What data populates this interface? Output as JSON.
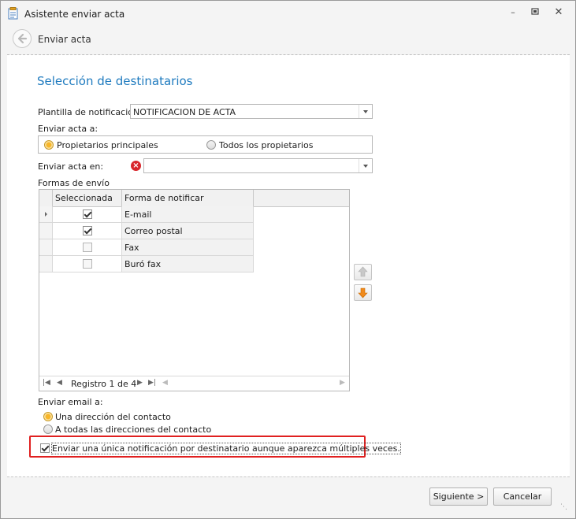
{
  "window": {
    "title": "Asistente enviar acta"
  },
  "header": {
    "title": "Enviar acta"
  },
  "section": {
    "title": "Selección de destinatarios"
  },
  "form": {
    "plantilla_label": "Plantilla de notificación:",
    "plantilla_value": "NOTIFICACION DE ACTA",
    "enviar_acta_a_label": "Enviar acta a:",
    "enviar_acta_a_options": [
      {
        "label": "Propietarios principales",
        "selected": true
      },
      {
        "label": "Todos los propietarios",
        "selected": false
      }
    ],
    "enviar_en_label": "Enviar acta en:",
    "enviar_en_value": "",
    "formas_label": "Formas de envío"
  },
  "grid": {
    "columns": [
      "Seleccionada",
      "Forma de notificar"
    ],
    "rows": [
      {
        "selected": true,
        "forma": "E-mail"
      },
      {
        "selected": true,
        "forma": "Correo postal"
      },
      {
        "selected": false,
        "forma": "Fax"
      },
      {
        "selected": false,
        "forma": "Buró fax"
      }
    ],
    "navigator_text": "Registro 1 de 4"
  },
  "email": {
    "label": "Enviar email a:",
    "options": [
      {
        "label": "Una dirección del contacto",
        "selected": true
      },
      {
        "label": "A todas las direcciones del contacto",
        "selected": false
      }
    ]
  },
  "unique_notification": {
    "label": "Enviar una única notificación por destinatario aunque aparezca múltiples veces.",
    "checked": true
  },
  "footer": {
    "next_label": "Siguiente >",
    "cancel_label": "Cancelar"
  },
  "colors": {
    "accent": "#1f7bbf",
    "radio_on": "#f7b62a",
    "error": "#d8262b",
    "highlight": "#e02020"
  }
}
